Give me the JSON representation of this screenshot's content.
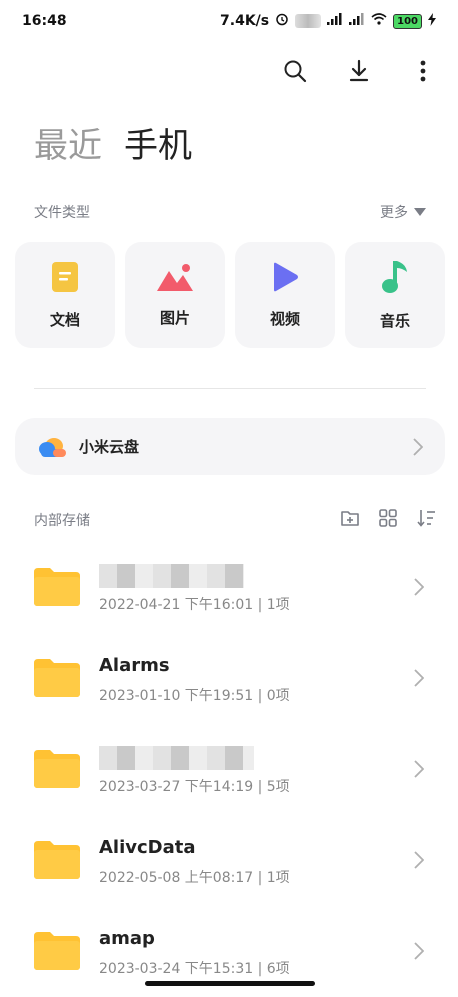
{
  "status_bar": {
    "time": "16:48",
    "speed": "7.4K/s",
    "battery": "100"
  },
  "tabs": [
    {
      "label": "最近"
    },
    {
      "label": "手机"
    }
  ],
  "file_types": {
    "title": "文件类型",
    "more_label": "更多",
    "items": [
      {
        "label": "文档",
        "color": "#f5c542"
      },
      {
        "label": "图片",
        "color": "#f25b6b"
      },
      {
        "label": "视频",
        "color": "#6b6ff2"
      },
      {
        "label": "音乐",
        "color": "#39c28a"
      }
    ]
  },
  "cloud": {
    "label": "小米云盘"
  },
  "storage": {
    "title": "内部存储"
  },
  "folders": [
    {
      "name": "",
      "meta": "2022-04-21 下午16:01 | 1项"
    },
    {
      "name": "Alarms",
      "meta": "2023-01-10 下午19:51 | 0项"
    },
    {
      "name": "",
      "meta": "2023-03-27 下午14:19 | 5项"
    },
    {
      "name": "AlivcData",
      "meta": "2022-05-08 上午08:17 | 1项"
    },
    {
      "name": "amap",
      "meta": "2023-03-24 下午15:31 | 6项"
    }
  ],
  "colors": {
    "folder": "#ffc233",
    "accent_text": "#7a7d86"
  }
}
